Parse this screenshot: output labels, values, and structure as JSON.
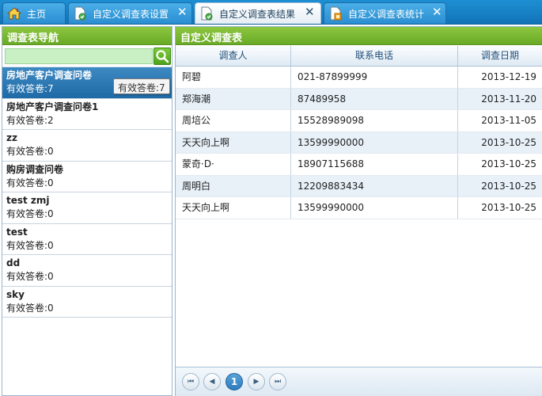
{
  "tabs": [
    {
      "label": "主页",
      "icon": "home-icon",
      "closable": false,
      "active": false
    },
    {
      "label": "自定义调查表设置",
      "icon": "document-settings-icon",
      "closable": true,
      "active": false
    },
    {
      "label": "自定义调查表结果",
      "icon": "document-result-icon",
      "closable": true,
      "active": true
    },
    {
      "label": "自定义调查表统计",
      "icon": "document-chart-icon",
      "closable": true,
      "active": false
    }
  ],
  "close_glyph": "✕",
  "sidebar": {
    "title": "调查表导航",
    "search_placeholder": "",
    "items": [
      {
        "name": "房地产客户调查问卷",
        "count": "有效答卷:7",
        "selected": true
      },
      {
        "name": "房地产客户调查问卷1",
        "count": "有效答卷:2",
        "selected": false
      },
      {
        "name": "zz",
        "count": "有效答卷:0",
        "selected": false
      },
      {
        "name": "购房调查问卷",
        "count": "有效答卷:0",
        "selected": false
      },
      {
        "name": "test zmj",
        "count": "有效答卷:0",
        "selected": false
      },
      {
        "name": "test",
        "count": "有效答卷:0",
        "selected": false
      },
      {
        "name": "dd",
        "count": "有效答卷:0",
        "selected": false
      },
      {
        "name": "sky",
        "count": "有效答卷:0",
        "selected": false
      }
    ],
    "tooltip": "有效答卷:7"
  },
  "main": {
    "title": "自定义调查表",
    "columns": [
      "调查人",
      "联系电话",
      "调查日期"
    ],
    "rows": [
      {
        "name": "阿碧",
        "phone": "021-87899999",
        "date": "2013-12-19"
      },
      {
        "name": "郑海潮",
        "phone": "87489958",
        "date": "2013-11-20"
      },
      {
        "name": "周培公",
        "phone": "15528989098",
        "date": "2013-11-05"
      },
      {
        "name": "天天向上啊",
        "phone": "13599990000",
        "date": "2013-10-25"
      },
      {
        "name": "蒙奇·D·",
        "phone": "18907115688",
        "date": "2013-10-25"
      },
      {
        "name": "周明白",
        "phone": "12209883434",
        "date": "2013-10-25"
      },
      {
        "name": "天天向上啊",
        "phone": "13599990000",
        "date": "2013-10-25"
      }
    ],
    "pager": {
      "first": "⏮",
      "prev": "◀",
      "current": "1",
      "next": "▶",
      "last": "⏭"
    }
  },
  "colors": {
    "tabbar": "#1273b8",
    "panel_header": "#6aaa26",
    "selected_row": "#1f6aa6",
    "alt_row": "#e8f1f8"
  }
}
